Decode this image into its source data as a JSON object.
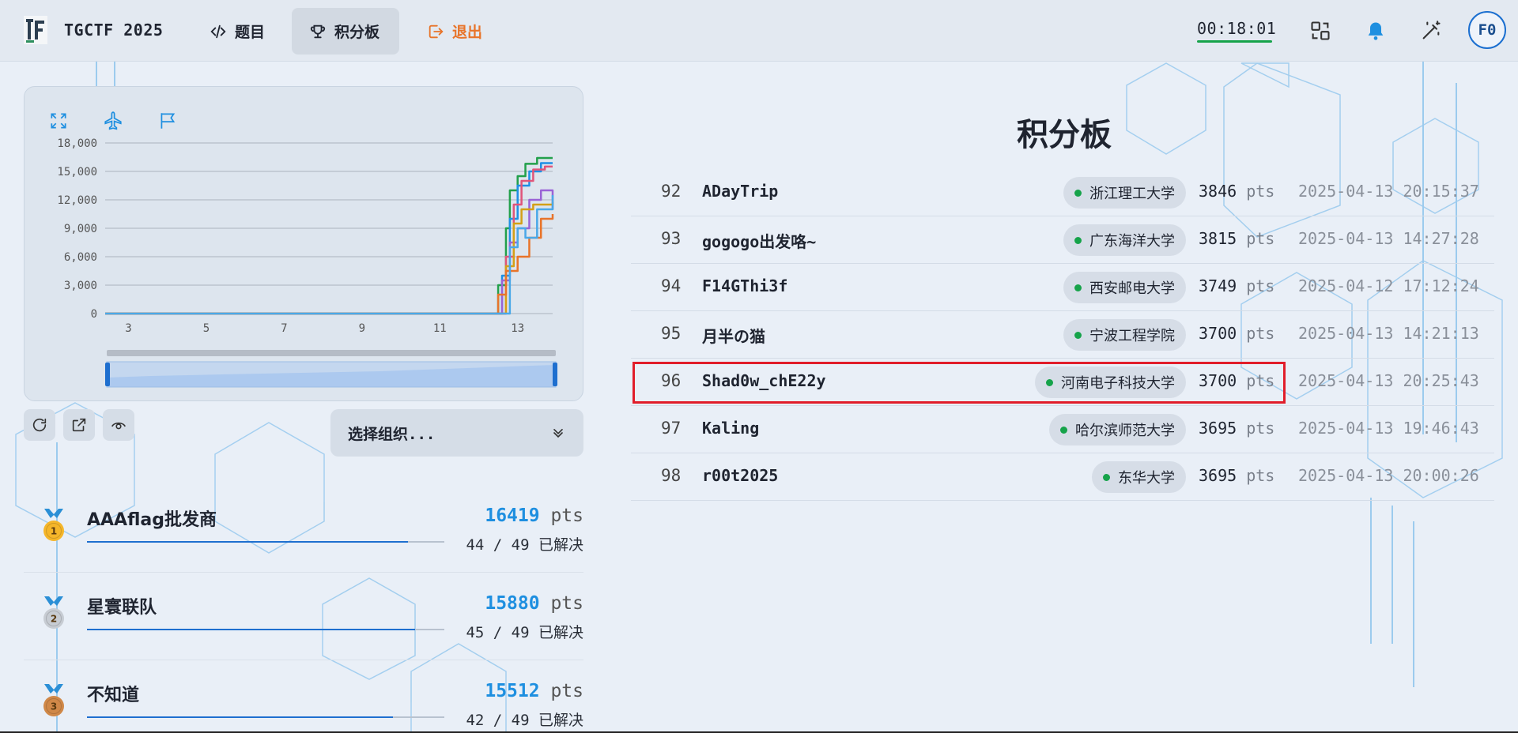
{
  "app": {
    "brand": "TGCTF 2025",
    "nav": {
      "problems": "题目",
      "scoreboard": "积分板",
      "logout": "退出"
    },
    "timer": "00:18:01",
    "avatar": "F0",
    "colors": {
      "accent": "#1e8fe0",
      "logout": "#e8742a",
      "highlight": "#e11d2a",
      "online": "#16a34a"
    },
    "icons": [
      "switch-icon",
      "bell-icon",
      "magic-wand-icon"
    ]
  },
  "chart": {
    "toolbar_icons": [
      "expand-icon",
      "airplane-icon",
      "flag-icon"
    ],
    "chart_data": {
      "type": "line",
      "x": [
        3,
        5,
        7,
        9,
        11,
        13
      ],
      "xlabel": "",
      "ylabel": "",
      "y_ticks": [
        "18,000",
        "15,000",
        "12,000",
        "9,000",
        "6,000",
        "3,000",
        "0"
      ],
      "x_ticks": [
        "3",
        "5",
        "7",
        "9",
        "11",
        "13"
      ],
      "ylim": [
        0,
        18000
      ],
      "xlim": [
        2.4,
        13.9
      ],
      "grid": true,
      "series": [
        {
          "color": "#22a04b",
          "points": [
            [
              12.3,
              0
            ],
            [
              12.5,
              3000
            ],
            [
              12.7,
              9000
            ],
            [
              12.8,
              13000
            ],
            [
              13.0,
              14500
            ],
            [
              13.2,
              15800
            ],
            [
              13.5,
              16419
            ],
            [
              13.9,
              16419
            ]
          ]
        },
        {
          "color": "#1e90e6",
          "points": [
            [
              12.4,
              0
            ],
            [
              12.6,
              4000
            ],
            [
              12.8,
              10000
            ],
            [
              13.0,
              13500
            ],
            [
              13.3,
              15000
            ],
            [
              13.6,
              15880
            ],
            [
              13.9,
              15880
            ]
          ]
        },
        {
          "color": "#e0557a",
          "points": [
            [
              12.5,
              0
            ],
            [
              12.7,
              6000
            ],
            [
              12.9,
              11500
            ],
            [
              13.1,
              14000
            ],
            [
              13.4,
              15200
            ],
            [
              13.7,
              15512
            ],
            [
              13.9,
              15512
            ]
          ]
        },
        {
          "color": "#9a63d6",
          "points": [
            [
              12.4,
              0
            ],
            [
              12.6,
              3500
            ],
            [
              12.8,
              7500
            ],
            [
              13.0,
              9000
            ],
            [
              13.3,
              12000
            ],
            [
              13.6,
              13000
            ],
            [
              13.9,
              11000
            ]
          ]
        },
        {
          "color": "#d4a017",
          "points": [
            [
              12.5,
              0
            ],
            [
              12.7,
              5000
            ],
            [
              12.9,
              9500
            ],
            [
              13.1,
              11000
            ],
            [
              13.4,
              11500
            ],
            [
              13.9,
              11800
            ]
          ]
        },
        {
          "color": "#e8742a",
          "points": [
            [
              12.3,
              0
            ],
            [
              12.5,
              2000
            ],
            [
              12.7,
              4500
            ],
            [
              13.0,
              6000
            ],
            [
              13.3,
              8000
            ],
            [
              13.6,
              10000
            ],
            [
              13.9,
              10500
            ]
          ]
        },
        {
          "color": "#4aa8e8",
          "points": [
            [
              12.6,
              0
            ],
            [
              12.8,
              7000
            ],
            [
              13.0,
              9000
            ],
            [
              13.2,
              8000
            ],
            [
              13.5,
              11000
            ],
            [
              13.9,
              12500
            ]
          ]
        }
      ]
    }
  },
  "controls": {
    "buttons": [
      "refresh-icon",
      "share-icon",
      "eye-icon"
    ],
    "org_select": "选择组织..."
  },
  "top_ranks": [
    {
      "name": "AAAflag批发商",
      "points": "16419",
      "unit": "pts",
      "solved": "44 / 49 已解决",
      "progress": 0.898,
      "medal": "1",
      "medal_color": "#f5b62a"
    },
    {
      "name": "星寰联队",
      "points": "15880",
      "unit": "pts",
      "solved": "45 / 49 已解决",
      "progress": 0.918,
      "medal": "2",
      "medal_color": "#c7ccd3"
    },
    {
      "name": "不知道",
      "points": "15512",
      "unit": "pts",
      "solved": "42 / 49 已解决",
      "progress": 0.857,
      "medal": "3",
      "medal_color": "#d08848"
    }
  ],
  "scoreboard": {
    "title": "积分板",
    "rows": [
      {
        "rank": "92",
        "name": "ADayTrip",
        "org": "浙江理工大学",
        "pts": "3846",
        "unit": "pts",
        "time": "2025-04-13 20:15:37"
      },
      {
        "rank": "93",
        "name": "gogogo出发咯~",
        "org": "广东海洋大学",
        "pts": "3815",
        "unit": "pts",
        "time": "2025-04-13 14:27:28"
      },
      {
        "rank": "94",
        "name": "F14GThi3f",
        "org": "西安邮电大学",
        "pts": "3749",
        "unit": "pts",
        "time": "2025-04-12 17:12:24"
      },
      {
        "rank": "95",
        "name": "月半の猫",
        "org": "宁波工程学院",
        "pts": "3700",
        "unit": "pts",
        "time": "2025-04-13 14:21:13"
      },
      {
        "rank": "96",
        "name": "Shad0w_chE22y",
        "org": "河南电子科技大学",
        "pts": "3700",
        "unit": "pts",
        "time": "2025-04-13 20:25:43"
      },
      {
        "rank": "97",
        "name": "Kaling",
        "org": "哈尔滨师范大学",
        "pts": "3695",
        "unit": "pts",
        "time": "2025-04-13 19:46:43"
      },
      {
        "rank": "98",
        "name": "r00t2025",
        "org": "东华大学",
        "pts": "3695",
        "unit": "pts",
        "time": "2025-04-13 20:00:26"
      }
    ]
  }
}
